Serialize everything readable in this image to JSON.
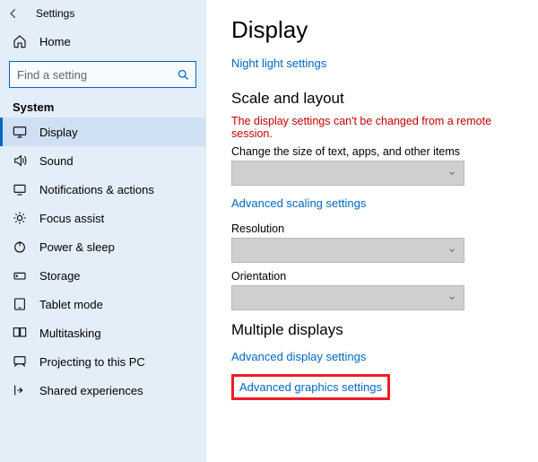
{
  "window": {
    "title": "Settings"
  },
  "sidebar": {
    "home": "Home",
    "search_placeholder": "Find a setting",
    "section": "System",
    "items": [
      {
        "label": "Display"
      },
      {
        "label": "Sound"
      },
      {
        "label": "Notifications & actions"
      },
      {
        "label": "Focus assist"
      },
      {
        "label": "Power & sleep"
      },
      {
        "label": "Storage"
      },
      {
        "label": "Tablet mode"
      },
      {
        "label": "Multitasking"
      },
      {
        "label": "Projecting to this PC"
      },
      {
        "label": "Shared experiences"
      }
    ]
  },
  "main": {
    "heading": "Display",
    "night_light_link": "Night light settings",
    "scale_heading": "Scale and layout",
    "remote_warning": "The display settings can't be changed from a remote session.",
    "scale_label": "Change the size of text, apps, and other items",
    "advanced_scaling_link": "Advanced scaling settings",
    "resolution_label": "Resolution",
    "orientation_label": "Orientation",
    "multiple_heading": "Multiple displays",
    "advanced_display_link": "Advanced display settings",
    "advanced_graphics_link": "Advanced graphics settings"
  }
}
